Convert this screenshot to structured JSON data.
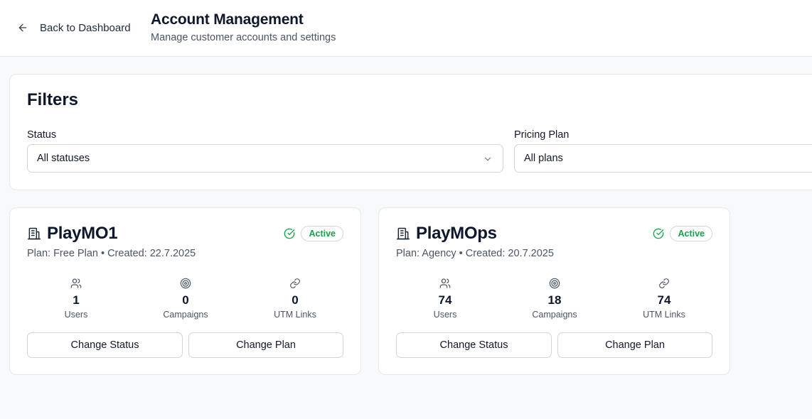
{
  "header": {
    "back_label": "Back to Dashboard",
    "title": "Account Management",
    "subtitle": "Manage customer accounts and settings"
  },
  "filters": {
    "title": "Filters",
    "status": {
      "label": "Status",
      "value": "All statuses"
    },
    "plan": {
      "label": "Pricing Plan",
      "value": "All plans"
    }
  },
  "accounts": [
    {
      "name": "PlayMO1",
      "status": "Active",
      "meta": "Plan: Free Plan • Created: 22.7.2025",
      "stats": [
        {
          "icon": "users-icon",
          "value": "1",
          "label": "Users"
        },
        {
          "icon": "target-icon",
          "value": "0",
          "label": "Campaigns"
        },
        {
          "icon": "link-icon",
          "value": "0",
          "label": "UTM Links"
        }
      ],
      "change_status_label": "Change Status",
      "change_plan_label": "Change Plan"
    },
    {
      "name": "PlayMOps",
      "status": "Active",
      "meta": "Plan: Agency • Created: 20.7.2025",
      "stats": [
        {
          "icon": "users-icon",
          "value": "74",
          "label": "Users"
        },
        {
          "icon": "target-icon",
          "value": "18",
          "label": "Campaigns"
        },
        {
          "icon": "link-icon",
          "value": "74",
          "label": "UTM Links"
        }
      ],
      "change_status_label": "Change Status",
      "change_plan_label": "Change Plan"
    }
  ],
  "colors": {
    "active_green": "#16a34a",
    "border": "#e5e7eb",
    "background": "#f8f9fa"
  }
}
